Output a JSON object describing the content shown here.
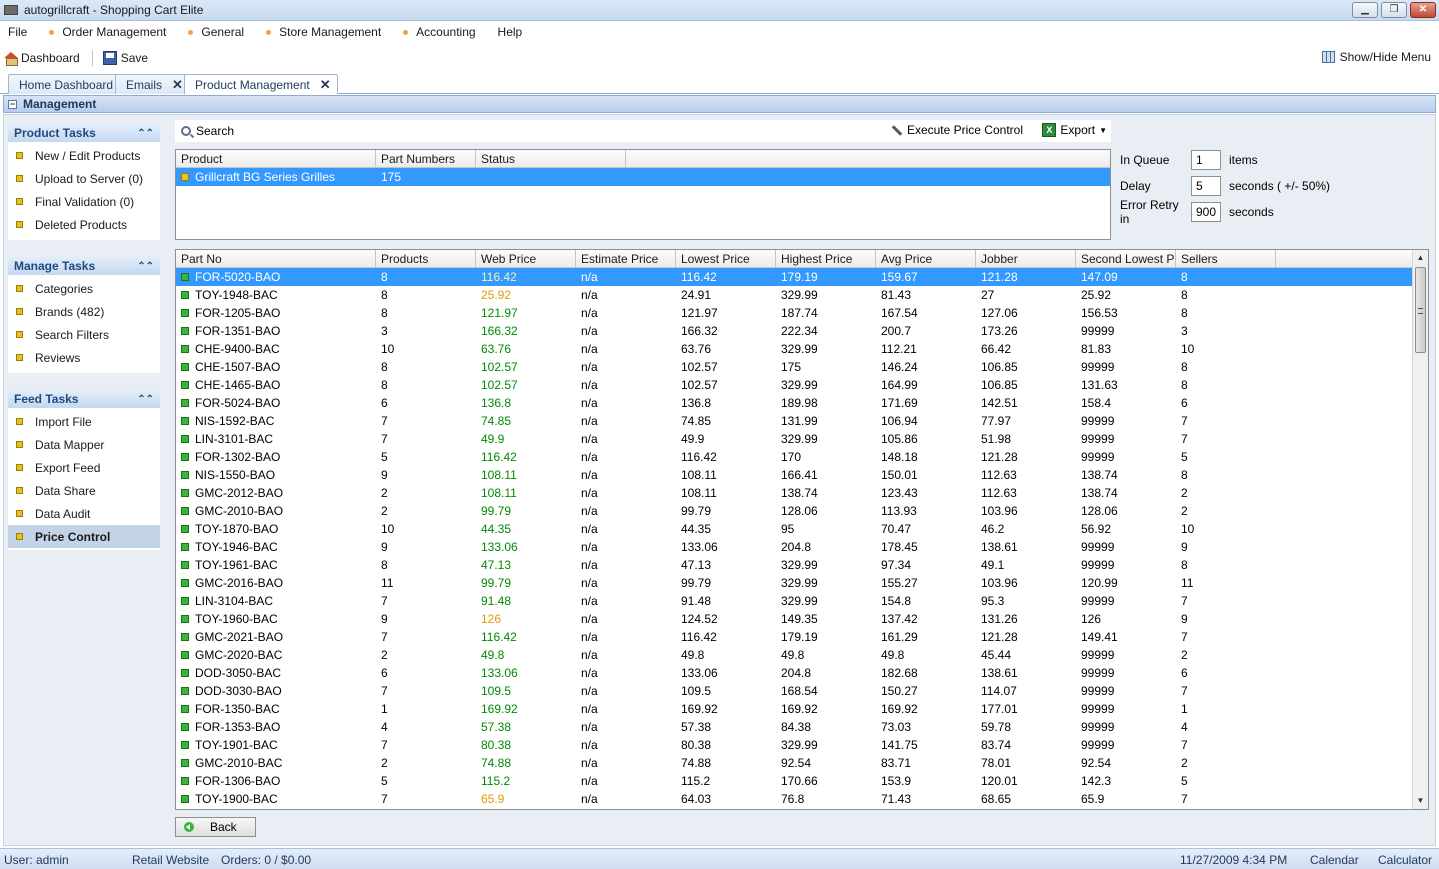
{
  "window": {
    "title": "autogrillcraft - Shopping Cart Elite"
  },
  "menu": [
    "File",
    "Order Management",
    "General",
    "Store Management",
    "Accounting",
    "Help"
  ],
  "toolbar": {
    "dashboard": "Dashboard",
    "save": "Save",
    "show_hide": "Show/Hide Menu"
  },
  "tabs": [
    {
      "label": "Home Dashboard"
    },
    {
      "label": "Emails"
    },
    {
      "label": "Product Management"
    }
  ],
  "section": {
    "title": "Management"
  },
  "panels": {
    "product": {
      "title": "Product Tasks",
      "items": [
        "New / Edit Products",
        "Upload to Server (0)",
        "Final Validation (0)",
        "Deleted Products"
      ]
    },
    "manage": {
      "title": "Manage Tasks",
      "items": [
        "Categories",
        "Brands (482)",
        "Search Filters",
        "Reviews"
      ]
    },
    "feed": {
      "title": "Feed Tasks",
      "items": [
        "Import File",
        "Data Mapper",
        "Export Feed",
        "Data Share",
        "Data Audit",
        "Price Control"
      ],
      "active_index": 5
    }
  },
  "search": {
    "label": "Search",
    "execute": "Execute Price Control",
    "export": "Export"
  },
  "product_grid": {
    "columns": [
      "Product",
      "Part Numbers",
      "Status"
    ],
    "rows": [
      {
        "product": "Grillcraft BG Series Grilles",
        "parts": "175",
        "status": ""
      }
    ]
  },
  "settings": {
    "in_queue": {
      "label": "In Queue",
      "value": "1",
      "unit": "items"
    },
    "delay": {
      "label": "Delay",
      "value": "5",
      "unit": "seconds ( +/- 50%)"
    },
    "retry": {
      "label": "Error Retry in",
      "value": "900",
      "unit": "seconds"
    }
  },
  "parts_grid": {
    "columns": [
      "Part No",
      "Products",
      "Web Price",
      "Estimate Price",
      "Lowest Price",
      "Highest Price",
      "Avg Price",
      "Jobber",
      "Second Lowest P",
      "Sellers"
    ],
    "rows": [
      [
        "FOR-5020-BAO",
        "8",
        "116.42",
        "n/a",
        "116.42",
        "179.19",
        "159.67",
        "121.28",
        "147.09",
        "8"
      ],
      [
        "TOY-1948-BAC",
        "8",
        "25.92",
        "n/a",
        "24.91",
        "329.99",
        "81.43",
        "27",
        "25.92",
        "8"
      ],
      [
        "FOR-1205-BAO",
        "8",
        "121.97",
        "n/a",
        "121.97",
        "187.74",
        "167.54",
        "127.06",
        "156.53",
        "8"
      ],
      [
        "FOR-1351-BAO",
        "3",
        "166.32",
        "n/a",
        "166.32",
        "222.34",
        "200.7",
        "173.26",
        "99999",
        "3"
      ],
      [
        "CHE-9400-BAC",
        "10",
        "63.76",
        "n/a",
        "63.76",
        "329.99",
        "112.21",
        "66.42",
        "81.83",
        "10"
      ],
      [
        "CHE-1507-BAO",
        "8",
        "102.57",
        "n/a",
        "102.57",
        "175",
        "146.24",
        "106.85",
        "99999",
        "8"
      ],
      [
        "CHE-1465-BAO",
        "8",
        "102.57",
        "n/a",
        "102.57",
        "329.99",
        "164.99",
        "106.85",
        "131.63",
        "8"
      ],
      [
        "FOR-5024-BAO",
        "6",
        "136.8",
        "n/a",
        "136.8",
        "189.98",
        "171.69",
        "142.51",
        "158.4",
        "6"
      ],
      [
        "NIS-1592-BAC",
        "7",
        "74.85",
        "n/a",
        "74.85",
        "131.99",
        "106.94",
        "77.97",
        "99999",
        "7"
      ],
      [
        "LIN-3101-BAC",
        "7",
        "49.9",
        "n/a",
        "49.9",
        "329.99",
        "105.86",
        "51.98",
        "99999",
        "7"
      ],
      [
        "FOR-1302-BAO",
        "5",
        "116.42",
        "n/a",
        "116.42",
        "170",
        "148.18",
        "121.28",
        "99999",
        "5"
      ],
      [
        "NIS-1550-BAO",
        "9",
        "108.11",
        "n/a",
        "108.11",
        "166.41",
        "150.01",
        "112.63",
        "138.74",
        "8"
      ],
      [
        "GMC-2012-BAO",
        "2",
        "108.11",
        "n/a",
        "108.11",
        "138.74",
        "123.43",
        "112.63",
        "138.74",
        "2"
      ],
      [
        "GMC-2010-BAO",
        "2",
        "99.79",
        "n/a",
        "99.79",
        "128.06",
        "113.93",
        "103.96",
        "128.06",
        "2"
      ],
      [
        "TOY-1870-BAO",
        "10",
        "44.35",
        "n/a",
        "44.35",
        "95",
        "70.47",
        "46.2",
        "56.92",
        "10"
      ],
      [
        "TOY-1946-BAC",
        "9",
        "133.06",
        "n/a",
        "133.06",
        "204.8",
        "178.45",
        "138.61",
        "99999",
        "9"
      ],
      [
        "TOY-1961-BAC",
        "8",
        "47.13",
        "n/a",
        "47.13",
        "329.99",
        "97.34",
        "49.1",
        "99999",
        "8"
      ],
      [
        "GMC-2016-BAO",
        "11",
        "99.79",
        "n/a",
        "99.79",
        "329.99",
        "155.27",
        "103.96",
        "120.99",
        "11"
      ],
      [
        "LIN-3104-BAC",
        "7",
        "91.48",
        "n/a",
        "91.48",
        "329.99",
        "154.8",
        "95.3",
        "99999",
        "7"
      ],
      [
        "TOY-1960-BAC",
        "9",
        "126",
        "n/a",
        "124.52",
        "149.35",
        "137.42",
        "131.26",
        "126",
        "9"
      ],
      [
        "GMC-2021-BAO",
        "7",
        "116.42",
        "n/a",
        "116.42",
        "179.19",
        "161.29",
        "121.28",
        "149.41",
        "7"
      ],
      [
        "GMC-2020-BAC",
        "2",
        "49.8",
        "n/a",
        "49.8",
        "49.8",
        "49.8",
        "45.44",
        "99999",
        "2"
      ],
      [
        "DOD-3050-BAC",
        "6",
        "133.06",
        "n/a",
        "133.06",
        "204.8",
        "182.68",
        "138.61",
        "99999",
        "6"
      ],
      [
        "DOD-3030-BAO",
        "7",
        "109.5",
        "n/a",
        "109.5",
        "168.54",
        "150.27",
        "114.07",
        "99999",
        "7"
      ],
      [
        "FOR-1350-BAC",
        "1",
        "169.92",
        "n/a",
        "169.92",
        "169.92",
        "169.92",
        "177.01",
        "99999",
        "1"
      ],
      [
        "FOR-1353-BAO",
        "4",
        "57.38",
        "n/a",
        "57.38",
        "84.38",
        "73.03",
        "59.78",
        "99999",
        "4"
      ],
      [
        "TOY-1901-BAC",
        "7",
        "80.38",
        "n/a",
        "80.38",
        "329.99",
        "141.75",
        "83.74",
        "99999",
        "7"
      ],
      [
        "GMC-2010-BAC",
        "2",
        "74.88",
        "n/a",
        "74.88",
        "92.54",
        "83.71",
        "78.01",
        "92.54",
        "2"
      ],
      [
        "FOR-1306-BAO",
        "5",
        "115.2",
        "n/a",
        "115.2",
        "170.66",
        "153.9",
        "120.01",
        "142.3",
        "5"
      ],
      [
        "TOY-1900-BAC",
        "7",
        "65.9",
        "n/a",
        "64.03",
        "76.8",
        "71.43",
        "68.65",
        "65.9",
        "7"
      ]
    ],
    "web_price_colors": [
      "green",
      "orange",
      "green",
      "green",
      "green",
      "green",
      "green",
      "green",
      "green",
      "green",
      "green",
      "green",
      "green",
      "green",
      "green",
      "green",
      "green",
      "green",
      "green",
      "orange",
      "green",
      "green",
      "green",
      "green",
      "green",
      "green",
      "green",
      "green",
      "green",
      "orange"
    ]
  },
  "back": {
    "label": "Back"
  },
  "statusbar": {
    "user": "User: admin",
    "site": "Retail Website",
    "orders": "Orders: 0 / $0.00",
    "datetime": "11/27/2009 4:34 PM",
    "calendar": "Calendar",
    "calculator": "Calculator"
  }
}
